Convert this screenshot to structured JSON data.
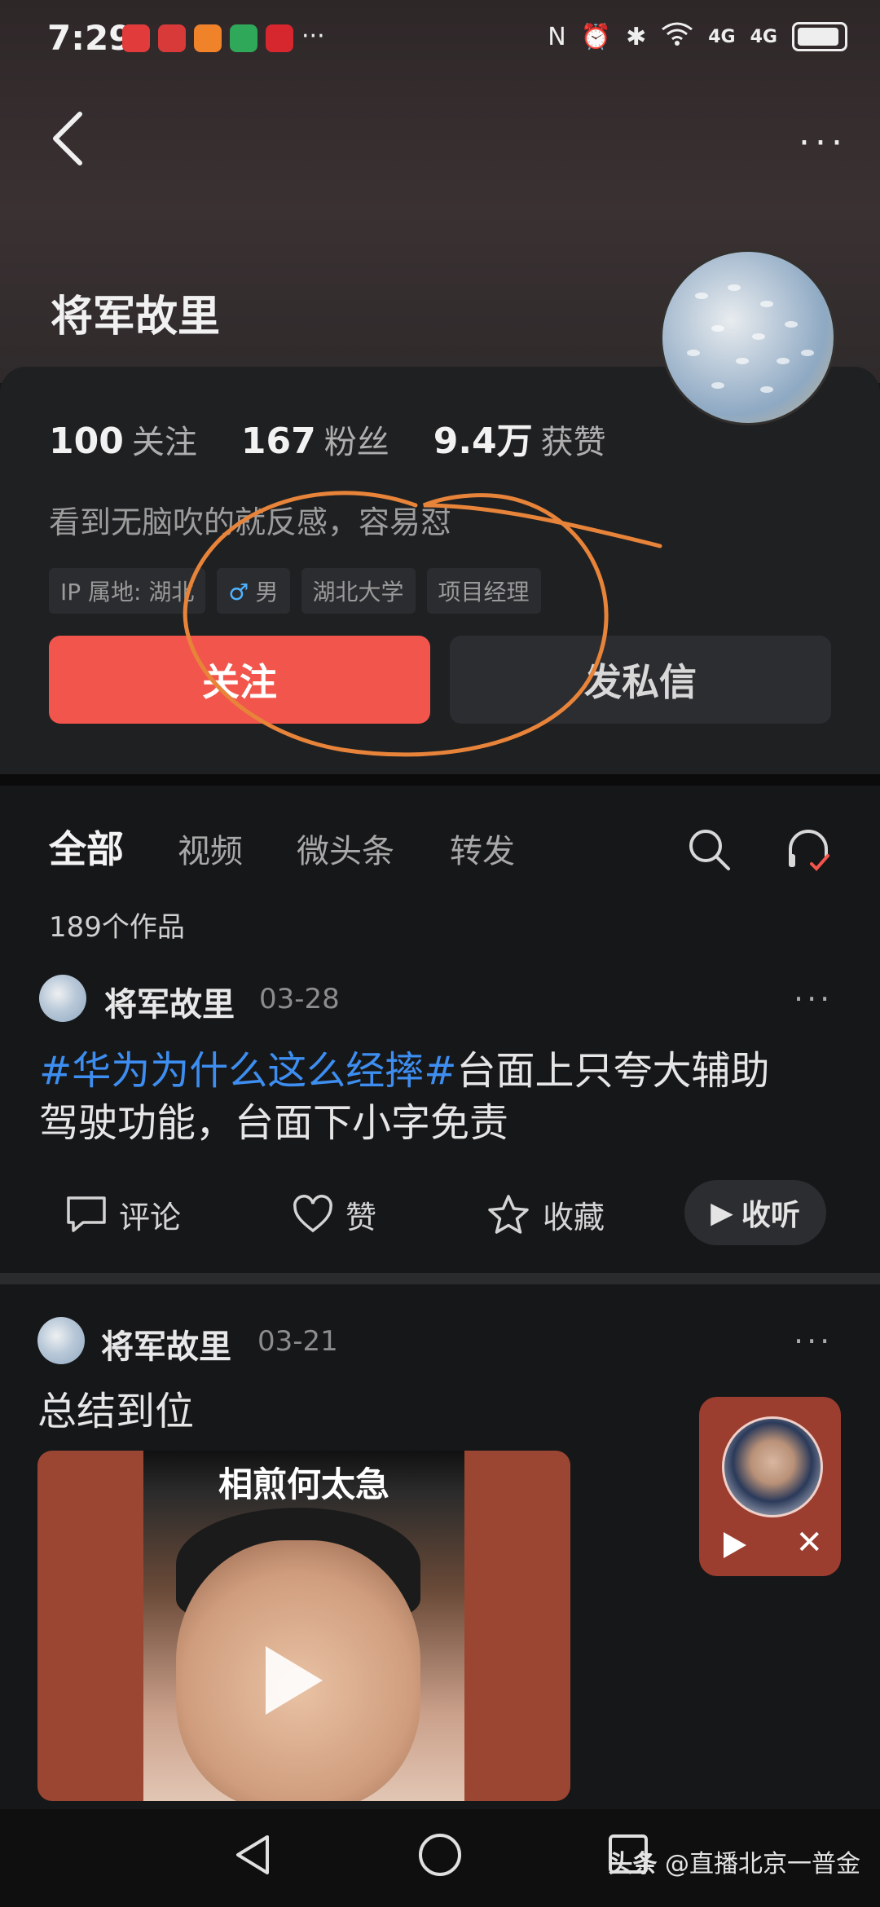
{
  "status": {
    "time": "7:29",
    "network1": "4G",
    "network2": "4G"
  },
  "profile": {
    "name": "将军故里",
    "stats": [
      {
        "num": "100",
        "label": "关注"
      },
      {
        "num": "167",
        "label": "粉丝"
      },
      {
        "num": "9.4万",
        "label": "获赞"
      }
    ],
    "bio": "看到无脑吹的就反感，容易怼",
    "tags": [
      "IP 属地: 湖北",
      "男",
      "湖北大学",
      "项目经理"
    ],
    "follow_label": "关注",
    "message_label": "发私信"
  },
  "tabs": [
    "全部",
    "视频",
    "微头条",
    "转发"
  ],
  "works_count": "189个作品",
  "posts": [
    {
      "author": "将军故里",
      "date": "03-28",
      "hashtag": "#华为为什么这么经摔#",
      "text_line1": "台面上只夸大辅助",
      "text_line2": "驾驶功能，台面下小字免责",
      "actions": {
        "comment": "评论",
        "like": "赞",
        "collect": "收藏",
        "listen": "收听"
      }
    },
    {
      "author": "将军故里",
      "date": "03-21",
      "text": "总结到位",
      "video_caption": "相煎何太急"
    }
  ],
  "watermark": {
    "brand": "头条",
    "handle": "@直播北京一普金"
  },
  "colors": {
    "accent": "#f2554b",
    "hashtag": "#3d8ef0",
    "annotation": "#e8843a"
  }
}
